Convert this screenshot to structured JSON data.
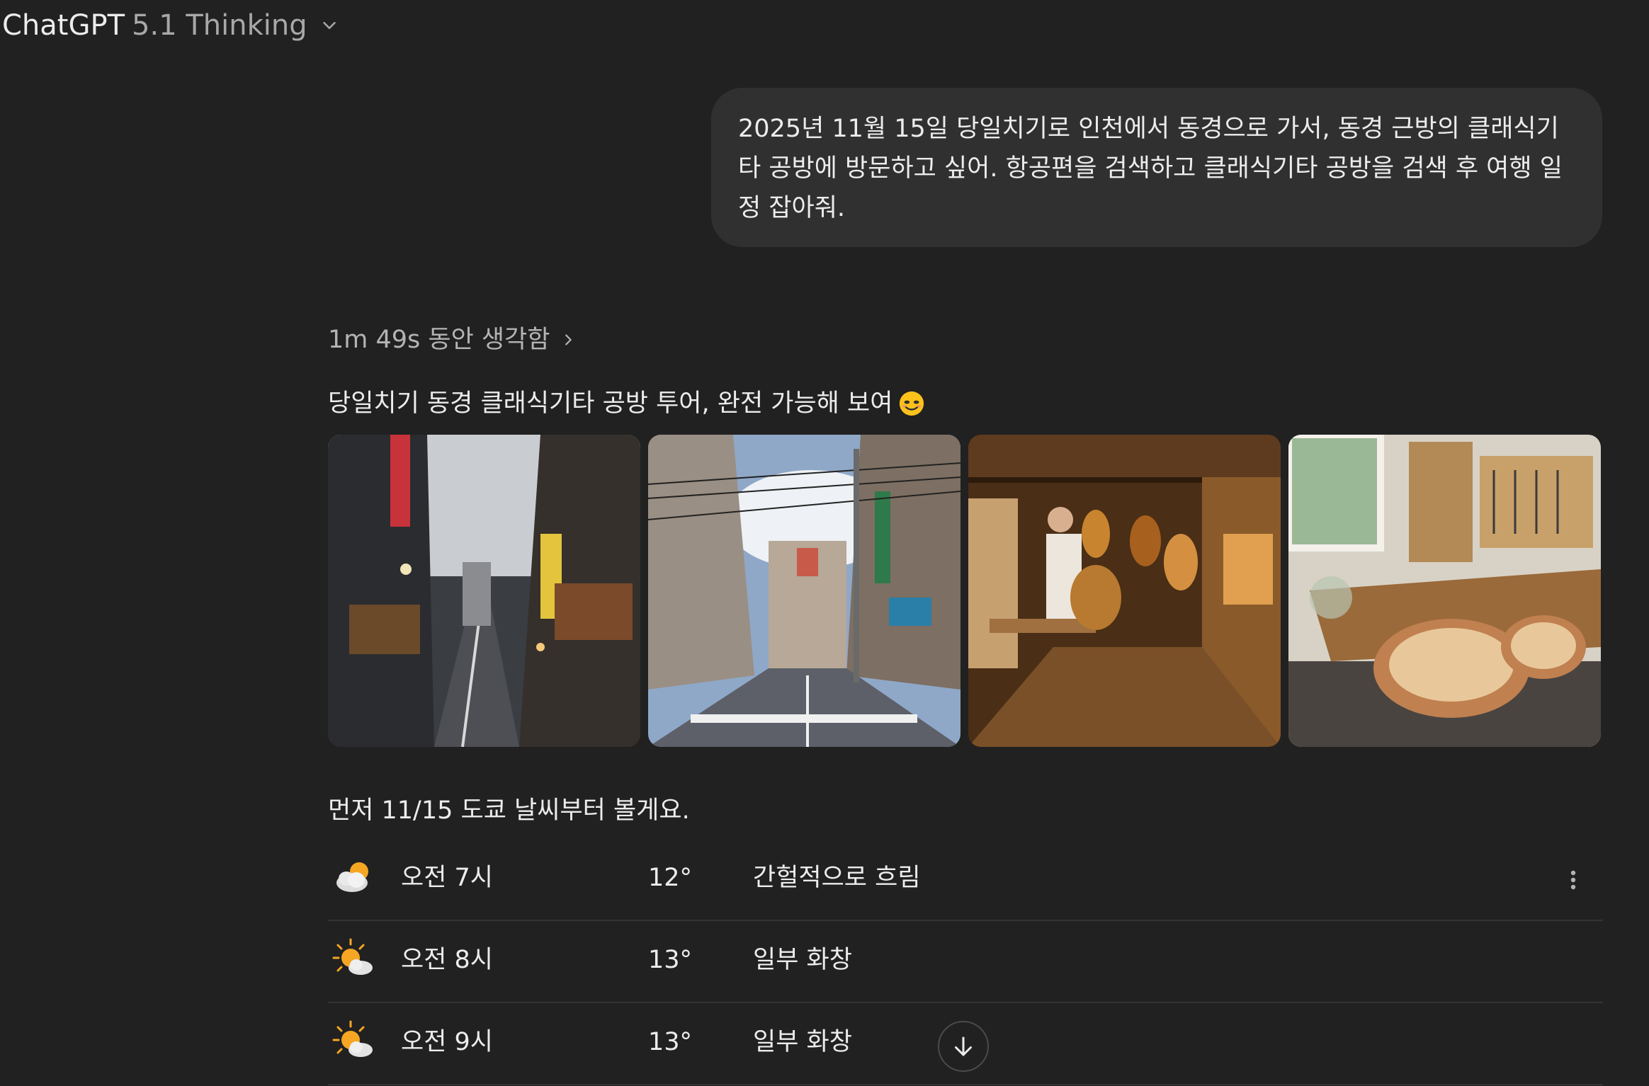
{
  "header": {
    "brand": "ChatGPT",
    "model": "5.1 Thinking",
    "chevron_icon": "chevron-down-icon"
  },
  "user_message": {
    "text": "2025년 11월 15일 당일치기로 인천에서 동경으로 가서, 동경 근방의 클래식기타 공방에 방문하고 싶어. 항공편을 검색하고 클래식기타 공방을 검색 후 여행 일정 잡아줘."
  },
  "assistant": {
    "thinking_label": "1m 49s 동안 생각함",
    "heading": "당일치기 동경 클래식기타 공방 투어, 완전 가능해 보여",
    "heading_emoji": "smiling-face-icon",
    "images": [
      {
        "name": "tokyo-street-night"
      },
      {
        "name": "tokyo-residential-street"
      },
      {
        "name": "guitar-workshop-luthier"
      },
      {
        "name": "guitar-workshop-bench"
      }
    ],
    "weather_intro": "먼저 11/15 도쿄 날씨부터 볼게요.",
    "weather_rows": [
      {
        "time": "오전 7시",
        "temp": "12°",
        "condition": "간헐적으로 흐림",
        "icon": "partly-cloudy-icon"
      },
      {
        "time": "오전 8시",
        "temp": "13°",
        "condition": "일부 화창",
        "icon": "sun-cloud-icon"
      },
      {
        "time": "오전 9시",
        "temp": "13°",
        "condition": "일부 화창",
        "icon": "sun-cloud-icon"
      }
    ]
  },
  "colors": {
    "background": "#212121",
    "bubble": "#303030",
    "text": "#ececec",
    "muted": "#a8a8a8",
    "sun": "#f5a623"
  }
}
